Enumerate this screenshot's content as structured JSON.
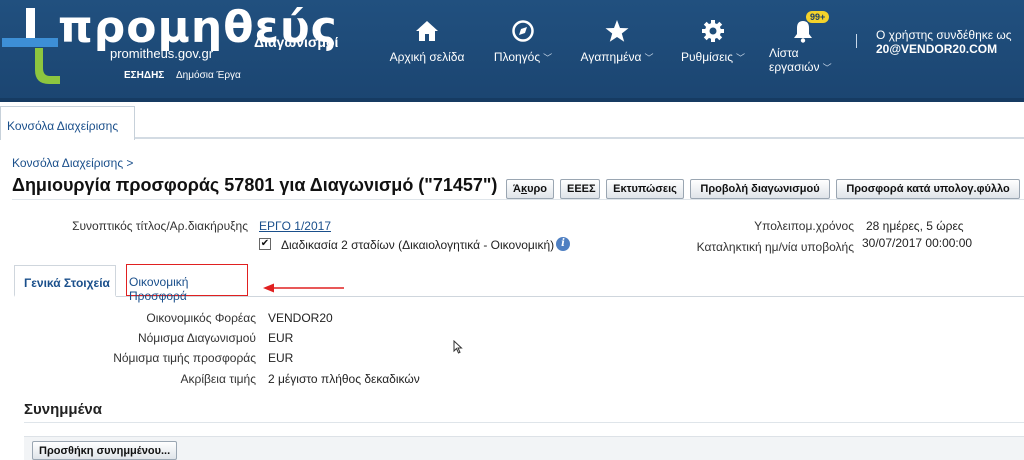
{
  "header": {
    "logo_word": "προμηθεύς",
    "logo_url": "promitheus.gov.gr",
    "logo_esidis": "ΕΣΗΔΗΣ",
    "logo_works": "Δημόσια Έργα",
    "app_name": "Διαγωνισμοί",
    "nav": [
      {
        "label": "Αρχική σελίδα",
        "icon": "home-icon"
      },
      {
        "label": "Πλοηγός",
        "icon": "compass-icon"
      },
      {
        "label": "Αγαπημένα",
        "icon": "star-icon"
      },
      {
        "label": "Ρυθμίσεις",
        "icon": "gear-icon"
      },
      {
        "label_line1": "Λίστα",
        "label_line2": "εργασιών",
        "icon": "bell-icon",
        "badge": "99+"
      }
    ],
    "user_line1": "Ο χρήστης συνδέθηκε ως",
    "user_line2": "20@VENDOR20.COM"
  },
  "console_tab": "Κονσόλα Διαχείρισης",
  "breadcrumb": "Κονσόλα Διαχείρισης  >",
  "page_title": "Δημιουργία προσφοράς 57801 για Διαγωνισμό (\"71457\")",
  "buttons": {
    "cancel": "Άκυρο",
    "eees": "ΕΕΕΣ",
    "prints": "Εκτυπώσεις",
    "view_tender": "Προβολή διαγωνισμού",
    "spreadsheet_offer": "Προσφορά κατά υπολογ.φύλλο"
  },
  "info": {
    "summary_label": "Συνοπτικός τίτλος/Αρ.διακήρυξης",
    "summary_value": "ΕΡΓΟ 1/2017",
    "two_stage_label": "Διαδικασία 2 σταδίων (Δικαιολογητικά - Οικονομική)",
    "remaining_label": "Υπολειπομ.χρόνος",
    "remaining_value": "28 ημέρες, 5 ώρες",
    "deadline_label": "Καταληκτική ημ/νία υποβολής",
    "deadline_value": "30/07/2017 00:00:00"
  },
  "subtabs": {
    "general": "Γενικά Στοιχεία",
    "financial": "Οικονομική Προσφορά"
  },
  "details": {
    "operator_label": "Οικονομικός Φορέας",
    "operator_value": "VENDOR20",
    "tender_currency_label": "Νόμισμα Διαγωνισμού",
    "tender_currency_value": "EUR",
    "offer_currency_label": "Νόμισμα τιμής προσφοράς",
    "offer_currency_value": "EUR",
    "precision_label": "Ακρίβεια τιμής",
    "precision_value": "2 μέγιστο πλήθος δεκαδικών"
  },
  "attachments": {
    "title": "Συνημμένα",
    "add_button": "Προσθήκη συνημμένου..."
  },
  "colors": {
    "header_bg": "#1f4e79",
    "link": "#1a4f8b",
    "highlight": "#e02020",
    "badge": "#f3d22b"
  }
}
